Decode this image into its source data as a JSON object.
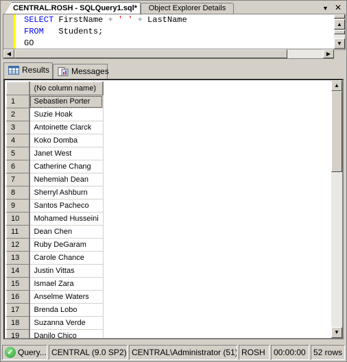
{
  "tabs": [
    {
      "label": "CENTRAL.ROSH - SQLQuery1.sql*",
      "active": true
    },
    {
      "label": "Object Explorer Details",
      "active": false
    }
  ],
  "tab_controls": {
    "dropdown_icon": "chevron-down-icon",
    "close_icon": "close-icon",
    "dropdown_glyph": "▼",
    "close_glyph": "✕"
  },
  "editor": {
    "lines": [
      {
        "keyword": "SELECT",
        "rest_a": " FirstName ",
        "op1": "+",
        "sp1": " ",
        "str": "' '",
        "sp2": " ",
        "op2": "+",
        "rest_b": " LastName"
      },
      {
        "keyword": "FROM",
        "rest": "   Students;"
      },
      {
        "text": "GO"
      }
    ]
  },
  "result_tabs": [
    {
      "label": "Results",
      "icon": "grid-icon",
      "active": true
    },
    {
      "label": "Messages",
      "icon": "messages-icon",
      "active": false
    }
  ],
  "grid": {
    "column_header": "(No column name)",
    "rows": [
      {
        "n": "1",
        "value": "Sebastien Porter"
      },
      {
        "n": "2",
        "value": "Suzie Hoak"
      },
      {
        "n": "3",
        "value": "Antoinette Clarck"
      },
      {
        "n": "4",
        "value": "Koko Domba"
      },
      {
        "n": "5",
        "value": "Janet West"
      },
      {
        "n": "6",
        "value": "Catherine Chang"
      },
      {
        "n": "7",
        "value": "Nehemiah Dean"
      },
      {
        "n": "8",
        "value": "Sherryl Ashburn"
      },
      {
        "n": "9",
        "value": "Santos Pacheco"
      },
      {
        "n": "10",
        "value": "Mohamed Husseini"
      },
      {
        "n": "11",
        "value": "Dean Chen"
      },
      {
        "n": "12",
        "value": "Ruby DeGaram"
      },
      {
        "n": "13",
        "value": "Carole Chance"
      },
      {
        "n": "14",
        "value": "Justin Vittas"
      },
      {
        "n": "15",
        "value": "Ismael Zara"
      },
      {
        "n": "16",
        "value": "Anselme Waters"
      },
      {
        "n": "17",
        "value": "Brenda Lobo"
      },
      {
        "n": "18",
        "value": "Suzanna Verde"
      },
      {
        "n": "19",
        "value": "Danilo Chico"
      }
    ]
  },
  "status_bar": {
    "query_status": "Query...",
    "server": "CENTRAL (9.0 SP2)",
    "user": "CENTRAL\\Administrator (51)",
    "database": "ROSH",
    "elapsed": "00:00:00",
    "row_count": "52 rows",
    "status_icon": "success-check-icon"
  }
}
